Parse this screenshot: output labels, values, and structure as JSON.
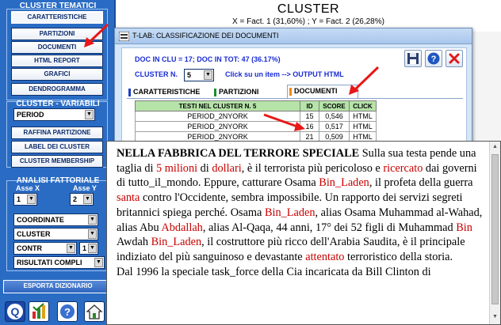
{
  "sidebar": {
    "cluster_title": "CLUSTER TEMATICI",
    "cluster_buttons": [
      "CARATTERISTICHE",
      "PARTIZIONI",
      "DOCUMENTI",
      "HTML REPORT",
      "GRAFICI",
      "DENDROGRAMMA"
    ],
    "variables_title": "CLUSTER - VARIABILI",
    "variable_select": "PERIOD",
    "variable_buttons": [
      "RAFFINA PARTIZIONE",
      "LABEL DEI CLUSTER",
      "CLUSTER MEMBERSHIP"
    ],
    "factorial_title": "ANALISI FATTORIALE",
    "axis_x_label": "Asse X",
    "axis_y_label": "Asse Y",
    "axis_x_value": "1",
    "axis_y_value": "2",
    "select_coord": "COORDINATE",
    "select_cluster": "CLUSTER",
    "select_contr": "CONTR",
    "select_contr_num": "1",
    "select_results": "RISULTATI COMPLI",
    "export_button": "ESPORTA DIZIONARIO",
    "toolbar_icon_q": "Q"
  },
  "main": {
    "title": "CLUSTER",
    "subtitle": "X = Fact. 1 (31,60%) ; Y = Fact. 2 (26,28%)"
  },
  "dialog": {
    "title": "T-LAB: CLASSIFICAZIONE DEI DOCUMENTI",
    "info_line": "DOC IN CLU = 17; DOC IN TOT: 47 (36.17%)",
    "cluster_label": "CLUSTER N.",
    "cluster_value": "5",
    "hint": "Click su un item --> OUTPUT HTML",
    "tabs": [
      "CARATTERISTICHE",
      "PARTIZIONI",
      "DOCUMENTI"
    ],
    "table": {
      "headers": [
        "TESTI NEL CLUSTER N. 5",
        "ID",
        "SCORE",
        "CLICK"
      ],
      "rows": [
        [
          "PERIOD_2NYORK",
          "15",
          "0,546",
          "HTML"
        ],
        [
          "PERIOD_2NYORK",
          "16",
          "0,517",
          "HTML"
        ],
        [
          "PERIOD_2NYORK",
          "21",
          "0,509",
          "HTML"
        ]
      ]
    }
  },
  "document": {
    "title": "NELLA FABBRICA DEL TERRORE SPECIALE",
    "p1": [
      "Sulla sua testa pende una taglia di ",
      "5",
      " ",
      "milioni",
      " di ",
      "dollari",
      ", è il terrorista più pericoloso e ",
      "ricercato",
      " dai governi di tutto_il_mondo. Eppure, catturare Osama ",
      "Bin_Laden",
      ", il profeta della guerra ",
      "santa",
      " contro l'Occidente, sembra impossibile. Un rapporto dei servizi segreti britannici spiega perché. Osama ",
      "Bin_Laden",
      ", alias Osama Muhammad al-Wahad, alias Abu ",
      "Abdallah",
      ", alias Al-Qaqa, 44 anni, 17° dei 52 figli di Muhammad ",
      "Bin",
      " Awdah ",
      "Bin_Laden",
      ", il costruttore più ricco dell'Arabia Saudita, è il principale indiziato del più sanguinoso e devastante ",
      "attentato",
      " terroristico della storia."
    ],
    "p2": "Dal 1996 la speciale task_force della Cia incaricata da Bill Clinton di"
  }
}
